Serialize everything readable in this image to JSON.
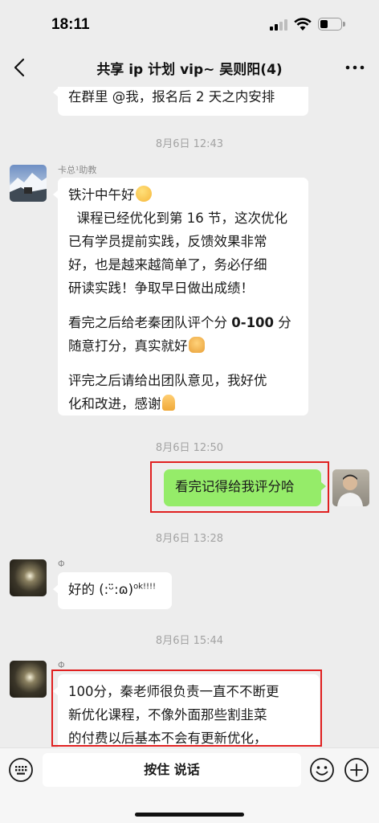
{
  "status_bar": {
    "time": "18:11"
  },
  "nav": {
    "title": "共享 ip 计划 vip~ 吴则阳(4)"
  },
  "messages": {
    "top_partial": {
      "text": "在群里 @我，报名后 2 天之内安排"
    },
    "ts1": "8月6日 12:43",
    "msg1": {
      "sender": "卡总¹助教",
      "line1": "铁汁中午好",
      "line2": "  课程已经优化到第 16 节，这次优化\n已有学员提前实践，反馈效果非常\n好，也是越来越简单了，务必仔细\n研读实践！争取早日做出成绩！",
      "line3_a": "看完之后给老秦团队评个分 ",
      "line3_b": "0-100",
      "line3_c": " 分\n随意打分，真实就好",
      "line4": "评完之后请给出团队意见，我好优\n化和改进，感谢"
    },
    "ts2": "8月6日 12:50",
    "msg2": {
      "text": "看完记得给我评分哈"
    },
    "ts3": "8月6日 13:28",
    "msg3": {
      "sender": "Φ",
      "text": "好的 (:ᵕ̈:ɷ)",
      "sup": "ok!!!!"
    },
    "ts4": "8月6日 15:44",
    "msg4": {
      "sender": "Φ",
      "text": "100分，秦老师很负责一直不不断更\n新优化课程，不像外面那些割韭菜\n的付费以后基本不会有更新优化，"
    }
  },
  "input_bar": {
    "hold_to_talk": "按住 说话"
  },
  "colors": {
    "background": "#ededed",
    "self_bubble": "#95ec69",
    "highlight": "#e02020"
  },
  "icons": [
    "back-arrow-icon",
    "more-icon",
    "voice-keyboard-icon",
    "emoji-icon",
    "plus-icon"
  ]
}
